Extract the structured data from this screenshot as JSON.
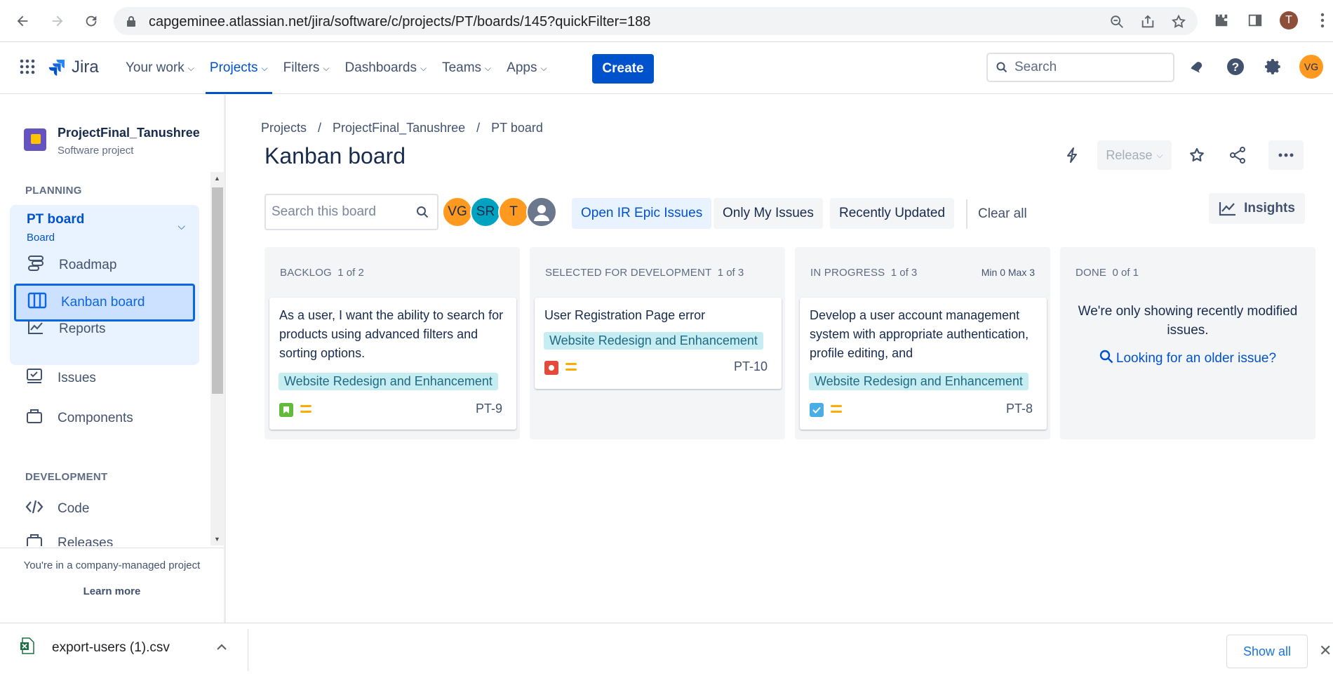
{
  "browser": {
    "url": "capgeminee.atlassian.net/jira/software/c/projects/PT/boards/145?quickFilter=188",
    "profile_initial": "T"
  },
  "topnav": {
    "logo": "Jira",
    "items": [
      {
        "label": "Your work"
      },
      {
        "label": "Projects"
      },
      {
        "label": "Filters"
      },
      {
        "label": "Dashboards"
      },
      {
        "label": "Teams"
      },
      {
        "label": "Apps"
      }
    ],
    "create_label": "Create",
    "search_placeholder": "Search",
    "user_initials": "VG",
    "active_color": "#0052CC"
  },
  "sidebar": {
    "project_name": "ProjectFinal_Tanushree",
    "project_type": "Software project",
    "planning_label": "PLANNING",
    "board_name": "PT board",
    "board_sub": "Board",
    "items": [
      {
        "label": "Roadmap",
        "icon": "roadmap-icon"
      },
      {
        "label": "Kanban board",
        "icon": "board-icon"
      },
      {
        "label": "Reports",
        "icon": "reports-icon"
      },
      {
        "label": "Issues",
        "icon": "issues-icon"
      },
      {
        "label": "Components",
        "icon": "components-icon"
      }
    ],
    "development_label": "DEVELOPMENT",
    "dev_items": [
      {
        "label": "Code",
        "icon": "code-icon"
      },
      {
        "label": "Releases",
        "icon": "releases-icon"
      }
    ],
    "footer_text": "You're in a company-managed project",
    "learn_more": "Learn more"
  },
  "main": {
    "breadcrumb": [
      "Projects",
      "/",
      "ProjectFinal_Tanushree",
      "/",
      "PT board"
    ],
    "title": "Kanban board",
    "release_label": "Release",
    "search_placeholder": "Search this board",
    "avatars": [
      {
        "initials": "VG",
        "color": "#FF991F"
      },
      {
        "initials": "SR",
        "color": "#00A3BF"
      },
      {
        "initials": "T",
        "color": "#FF991F"
      },
      {
        "initials": "",
        "color": "#6B778C"
      }
    ],
    "quick_filters": [
      {
        "label": "Open IR Epic Issues",
        "active": true
      },
      {
        "label": "Only My Issues",
        "active": false
      },
      {
        "label": "Recently Updated",
        "active": false
      }
    ],
    "clear_all": "Clear all",
    "insights_label": "Insights"
  },
  "columns": [
    {
      "name": "BACKLOG",
      "count": "1 of 2",
      "card": {
        "summary": "As a user, I want the ability to search for products using advanced filters and sorting options.",
        "epic": "Website Redesign and Enhancement",
        "type": "story",
        "key": "PT-9"
      }
    },
    {
      "name": "SELECTED FOR DEVELOPMENT",
      "count": "1 of 3",
      "card": {
        "summary": "User Registration Page error",
        "epic": "Website Redesign and Enhancement",
        "type": "bug",
        "key": "PT-10"
      }
    },
    {
      "name": "IN PROGRESS",
      "count": "1 of 3",
      "limits": "Min 0  Max 3",
      "card": {
        "summary": "Develop a user account management system with appropriate authentication, profile editing, and",
        "epic": "Website Redesign and Enhancement",
        "type": "task",
        "key": "PT-8"
      }
    },
    {
      "name": "DONE",
      "count": "0 of 1",
      "message": "We're only showing recently modified issues.",
      "link": "Looking for an older issue?"
    }
  ],
  "downloads": {
    "file": "export-users (1).csv",
    "show_all": "Show all"
  }
}
